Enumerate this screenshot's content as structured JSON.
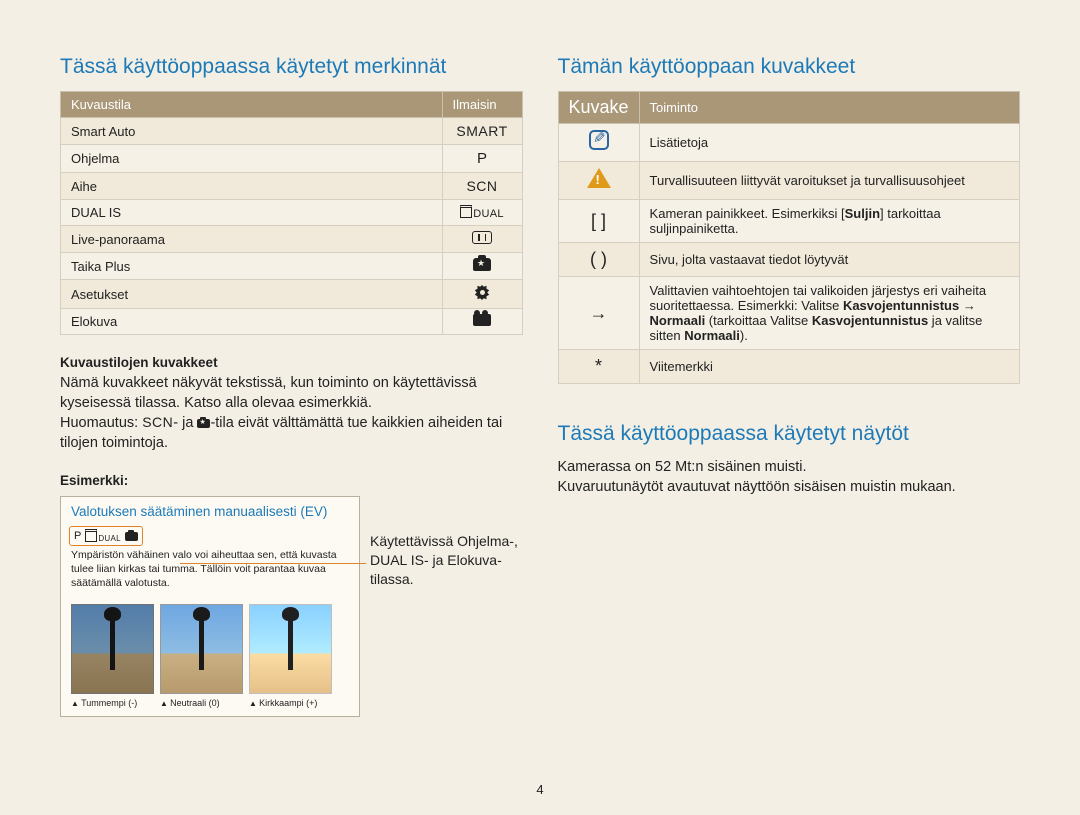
{
  "page_number": "4",
  "left": {
    "heading": "Tässä käyttöoppaassa käytetyt merkinnät",
    "table": {
      "h1": "Kuvaustila",
      "h2": "Ilmaisin",
      "rows": [
        {
          "mode": "Smart Auto",
          "ind": "SMART"
        },
        {
          "mode": "Ohjelma",
          "ind": "P"
        },
        {
          "mode": "Aihe",
          "ind": "SCN"
        },
        {
          "mode": "DUAL IS",
          "ind": "DUAL"
        },
        {
          "mode": "Live-panoraama",
          "ind": "pano"
        },
        {
          "mode": "Taika Plus",
          "ind": "magic"
        },
        {
          "mode": "Asetukset",
          "ind": "gear"
        },
        {
          "mode": "Elokuva",
          "ind": "movie"
        }
      ]
    },
    "sub1": "Kuvaustilojen kuvakkeet",
    "p1": "Nämä kuvakkeet näkyvät tekstissä, kun toiminto on käytettävissä kyseisessä tilassa. Katso alla olevaa esimerkkiä.",
    "p2a": "Huomautus: ",
    "p2b": "- ja ",
    "p2c": "-tila eivät välttämättä tue kaikkien aiheiden tai tilojen toimintoja.",
    "sub2": "Esimerkki:",
    "example": {
      "title": "Valotuksen säätäminen manuaalisesti (EV)",
      "body": "Ympäristön vähäinen valo voi aiheuttaa sen, että kuvasta tulee liian kirkas tai tumma. Tällöin voit parantaa kuvaa säätämällä valotusta.",
      "c1": "Tummempi (-)",
      "c2": "Neutraali (0)",
      "c3": "Kirkkaampi (+)"
    },
    "note": "Käytettävissä Ohjelma-, DUAL IS- ja Elokuva-tilassa."
  },
  "right": {
    "heading": "Tämän käyttöoppaan kuvakkeet",
    "table": {
      "h1": "Kuvake",
      "h2": "Toiminto",
      "rows": [
        {
          "ic": "info",
          "desc": "Lisätietoja"
        },
        {
          "ic": "warn",
          "desc": "Turvallisuuteen liittyvät varoitukset ja turvallisuusohjeet"
        },
        {
          "ic": "[ ]",
          "desc_a": "Kameran painikkeet. Esimerkiksi [",
          "bold1": "Suljin",
          "desc_b": "] tarkoittaa suljinpainiketta."
        },
        {
          "ic": "( )",
          "desc": "Sivu, jolta vastaavat tiedot löytyvät"
        },
        {
          "ic": "→",
          "desc_a": "Valittavien vaihtoehtojen tai valikoiden järjestys eri vaiheita suoritettaessa. Esimerkki: Valitse ",
          "bold1": "Kasvojentunnistus",
          "arrow": " → ",
          "bold2": "Normaali",
          "desc_b": " (tarkoittaa Valitse ",
          "bold3": "Kasvojentunnistus",
          "desc_c": " ja valitse sitten ",
          "bold4": "Normaali",
          "desc_d": ")."
        },
        {
          "ic": "*",
          "desc": "Viitemerkki"
        }
      ]
    },
    "heading2": "Tässä käyttöoppaassa käytetyt näytöt",
    "p1": "Kamerassa on 52 Mt:n sisäinen muisti.",
    "p2": "Kuvaruutunäytöt avautuvat näyttöön sisäisen muistin mukaan."
  }
}
